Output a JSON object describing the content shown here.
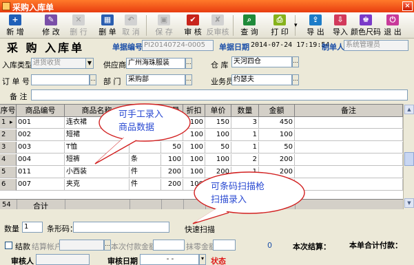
{
  "window": {
    "title": "采购入库单",
    "close": "×"
  },
  "toolbar": [
    {
      "name": "new-button",
      "icon": "plus-icon",
      "label": "新 增",
      "color": "#1f5fb8",
      "glyph": "+",
      "disabled": false
    },
    {
      "name": "edit-button",
      "icon": "edit-icon",
      "label": "修 改",
      "color": "#7a4fa8",
      "glyph": "✎",
      "disabled": false
    },
    {
      "name": "delete-row-button",
      "icon": "delete-row-icon",
      "label": "删 行",
      "color": "#d2d2d2",
      "glyph": "✕",
      "disabled": true
    },
    {
      "name": "delete-doc-button",
      "icon": "trash-icon",
      "label": "删 单",
      "color": "#2a5db0",
      "glyph": "▦",
      "disabled": false
    },
    {
      "name": "cancel-button",
      "icon": "undo-icon",
      "label": "取 消",
      "color": "#d2d2d2",
      "glyph": "↶",
      "disabled": true
    },
    {
      "name": "save-button",
      "icon": "save-icon",
      "label": "保 存",
      "color": "#d2d2d2",
      "glyph": "▣",
      "disabled": true
    },
    {
      "name": "approve-button",
      "icon": "approve-icon",
      "label": "审 核",
      "color": "#c8241c",
      "glyph": "✔",
      "disabled": false
    },
    {
      "name": "unapprove-button",
      "icon": "unapprove-icon",
      "label": "反审核",
      "color": "#d2d2d2",
      "glyph": "✘",
      "disabled": true
    },
    {
      "name": "query-button",
      "icon": "search-icon",
      "label": "查 询",
      "color": "#1f8a3a",
      "glyph": "⌕",
      "disabled": false
    },
    {
      "name": "print-button",
      "icon": "printer-icon",
      "label": "打 印",
      "color": "#86b21c",
      "glyph": "⎙",
      "disabled": false
    },
    {
      "name": "export-button",
      "icon": "export-icon",
      "label": "导 出",
      "color": "#1c7cc8",
      "glyph": "⇪",
      "disabled": false
    },
    {
      "name": "import-button",
      "icon": "import-icon",
      "label": "导入",
      "color": "#d23a5c",
      "glyph": "⇩",
      "disabled": false
    },
    {
      "name": "color-size-button",
      "icon": "shirt-icon",
      "label": "颜色尺码",
      "color": "#7a3ac8",
      "glyph": "♚",
      "disabled": false
    },
    {
      "name": "exit-button",
      "icon": "power-icon",
      "label": "退 出",
      "color": "#c83a9a",
      "glyph": "⏻",
      "disabled": false
    }
  ],
  "print_dropdown": "▾",
  "header": {
    "form_title": "采 购 入库单",
    "doc_no_label": "单据编号",
    "doc_no_value": "PI20140724-0005",
    "doc_date_label": "单据日期",
    "doc_date_value": "2014-07-24 17:19:54",
    "creator_label": "制单人",
    "creator_value": "系统管理员",
    "stock_type_label": "入库类型",
    "stock_type_value": "进货收货",
    "supplier_label": "供应商",
    "supplier_value": "广州海珠服装",
    "warehouse_label": "仓    库",
    "warehouse_value": "天河四仓",
    "order_no_label": "订 单 号",
    "order_no_value": "",
    "dept_label": "部    门",
    "dept_value": "采购部",
    "clerk_label": "业务员",
    "clerk_value": "约瑟夫",
    "remark_label": "备    注",
    "remark_value": "",
    "dots": "..."
  },
  "grid": {
    "columns": [
      "序号",
      "商品编号",
      "商品名称",
      "单位",
      "数量",
      "折扣",
      "单价",
      "数量",
      "金额",
      "备注"
    ],
    "rows": [
      {
        "no": "1",
        "code": "001",
        "name": "连衣裙",
        "unit": "",
        "qty1": "",
        "disc": "100",
        "price": "150",
        "qty": "3",
        "amt": "450",
        "pointer": "▸"
      },
      {
        "no": "2",
        "code": "002",
        "name": "短裙",
        "unit": "",
        "qty1": "",
        "disc": "100",
        "price": "100",
        "qty": "1",
        "amt": "100",
        "pointer": ""
      },
      {
        "no": "3",
        "code": "003",
        "name": "T恤",
        "unit": "",
        "qty1": "50",
        "disc": "100",
        "price": "50",
        "qty": "1",
        "amt": "50",
        "pointer": ""
      },
      {
        "no": "4",
        "code": "004",
        "name": "短裤",
        "unit": "条",
        "qty1": "100",
        "disc": "100",
        "price": "100",
        "qty": "2",
        "amt": "200",
        "pointer": ""
      },
      {
        "no": "5",
        "code": "011",
        "name": "小西装",
        "unit": "件",
        "qty1": "200",
        "disc": "100",
        "price": "200",
        "qty": "1",
        "amt": "200",
        "pointer": ""
      },
      {
        "no": "6",
        "code": "007",
        "name": "夹克",
        "unit": "件",
        "qty1": "200",
        "disc": "100",
        "price": "200",
        "qty": "1",
        "amt": "200",
        "pointer": ""
      }
    ],
    "total_row": {
      "no": "54",
      "label": "合计"
    }
  },
  "callouts": {
    "manual": [
      "可手工录入",
      "商品数据"
    ],
    "barcode": [
      "可条码扫描枪",
      "扫描录入"
    ]
  },
  "bottom": {
    "qty_label": "数量",
    "qty_value": "1",
    "barcode_label": "条形码：",
    "barcode_value": "",
    "quick_scan": "快速扫描",
    "settle_label": "结款",
    "account_label": "结算帐户",
    "paid_label": "本次付款金额",
    "paid_value": "",
    "discount_label": "抹零金额",
    "zero_value": "0",
    "this_settle_label": "本次结算：",
    "doc_total_label": "本单合计付款：",
    "auditor_label": "审核人",
    "audit_date_label": "审核日期",
    "audit_date_value": "-   -",
    "status_label": "状态"
  },
  "colors": {
    "accent_blue": "#1b4fa8",
    "status_red": "#e01a1a",
    "callout_text": "#2a4ad2"
  }
}
